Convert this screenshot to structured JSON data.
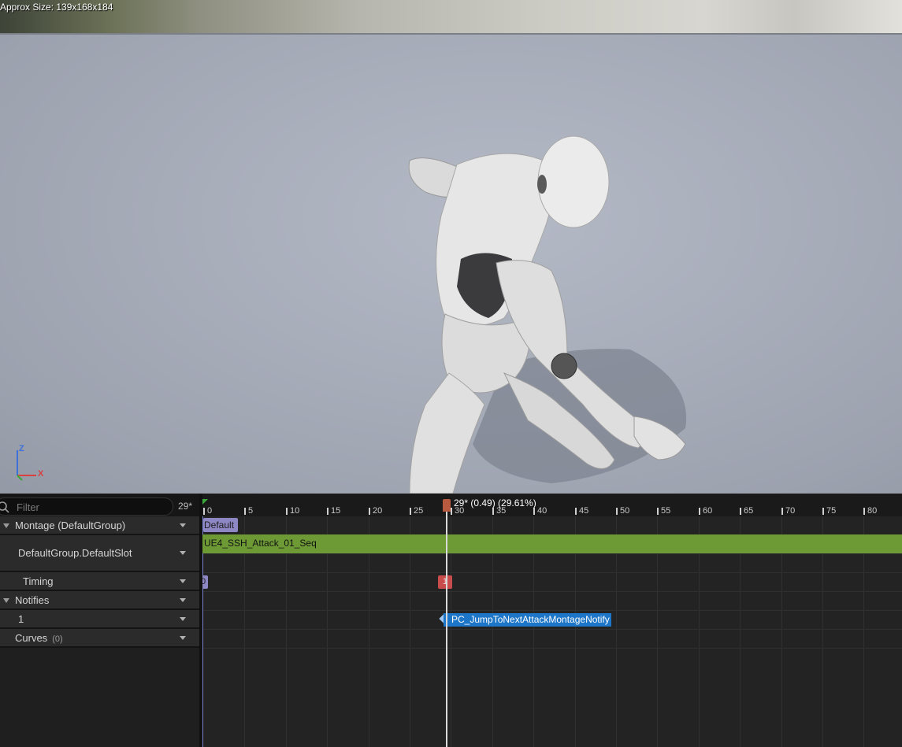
{
  "viewport": {
    "approx_size": "Approx Size: 139x168x184",
    "axis": {
      "z": "Z",
      "x": "X"
    }
  },
  "filter": {
    "placeholder": "Filter",
    "frame": "29*"
  },
  "tracks": [
    {
      "label": "Montage (DefaultGroup)"
    },
    {
      "label": "DefaultGroup.DefaultSlot"
    },
    {
      "label": "Timing"
    },
    {
      "label": "Notifies"
    },
    {
      "label": "1"
    },
    {
      "label": "Curves",
      "count": "(0)"
    }
  ],
  "timeline": {
    "ticks": [
      "0",
      "5",
      "10",
      "15",
      "20",
      "25",
      "30",
      "35",
      "40",
      "45",
      "50",
      "55",
      "60",
      "65",
      "70",
      "75",
      "80"
    ],
    "playhead_label": "29* (0.49) (29.61%)",
    "section_label": "Default",
    "segment_label": "UE4_SSH_Attack_01_Seq",
    "timing_chip_0": "0",
    "timing_chip_1": "1",
    "notify_label": "PC_JumpToNextAttackMontageNotify"
  },
  "colors": {
    "segment": "#6e9a36",
    "notify": "#1e76c9",
    "section": "#8d87c4",
    "playhead": "#b85a3f"
  }
}
